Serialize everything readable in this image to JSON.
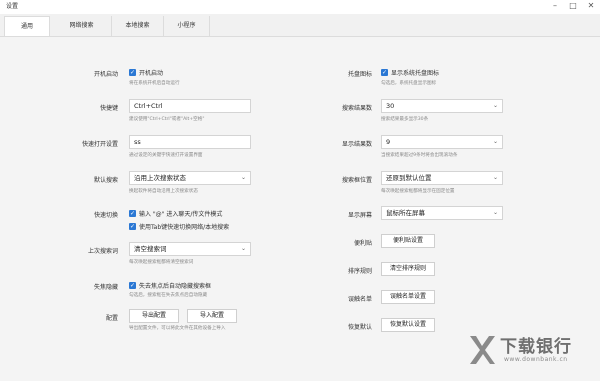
{
  "window": {
    "title": "设置",
    "minimize": "–",
    "maximize": "□",
    "close": "✕"
  },
  "tabs": [
    {
      "label": "通用",
      "active": true
    },
    {
      "label": "网络搜索",
      "active": false
    },
    {
      "label": "本地搜索",
      "active": false
    },
    {
      "label": "小程序",
      "active": false
    }
  ],
  "left": {
    "autostart": {
      "label": "开机启动",
      "checkbox": "开机启动",
      "hint": "将在系统开机后自动运行"
    },
    "hotkey": {
      "label": "快捷键",
      "value": "Ctrl+Ctrl",
      "hint": "建议使用\"Ctrl+Ctrl\"或者\"Alt+空格\""
    },
    "quick_open": {
      "label": "快速打开设置",
      "value": "ss",
      "hint": "通过设定的关键字快速打开设置界面"
    },
    "default_search": {
      "label": "默认搜索",
      "value": "沿用上次搜索状态",
      "hint": "换起软件将自动沿用上次搜索状态"
    },
    "quick_switch": {
      "label": "快速切换",
      "option1": "输入 \"@\" 进入聊天/传文件模式",
      "option2": "使用Tab键快速切换网络/本地搜索"
    },
    "last_search": {
      "label": "上次搜索词",
      "value": "清空搜索词",
      "hint": "每次唤起搜索框都将清空搜索词"
    },
    "lose_focus": {
      "label": "失焦隐藏",
      "checkbox": "失去焦点后自动隐藏搜索框",
      "hint": "勾选后，搜索框在失去焦点后自动隐藏"
    },
    "config": {
      "label": "配置",
      "export": "导出配置",
      "import": "导入配置",
      "hint": "导出配置文件，可以将此文件在其他设备上导入"
    }
  },
  "right": {
    "tray": {
      "label": "托盘图标",
      "checkbox": "显示系统托盘图标",
      "hint": "勾选后，系统托盘显示图标"
    },
    "result_count": {
      "label": "搜索结果数",
      "value": "30",
      "hint": "搜索结果最多显示30条"
    },
    "display_count": {
      "label": "显示结果数",
      "value": "9",
      "hint": "当搜索结果超过9条时将会出现滚动条"
    },
    "box_position": {
      "label": "搜索框位置",
      "value": "还原到默认位置",
      "hint": "每次唤起搜索框都将显示在固定位置"
    },
    "display_screen": {
      "label": "显示屏幕",
      "value": "鼠标所在屏幕"
    },
    "sticky": {
      "label": "便利贴",
      "button": "便利贴设置"
    },
    "sort_rules": {
      "label": "排序规则",
      "button": "清空排序规则"
    },
    "error_list": {
      "label": "误触名单",
      "button": "误触名单设置"
    },
    "restore": {
      "label": "恢复默认",
      "button": "恢复默认设置"
    }
  },
  "icons": {
    "check": "check-icon",
    "chevron": "chevron-down-icon"
  },
  "colors": {
    "accent": "#2b78d4",
    "background": "#f4f4f4"
  },
  "watermark": {
    "text": "下载银行",
    "url": "www.downbank.cn"
  }
}
